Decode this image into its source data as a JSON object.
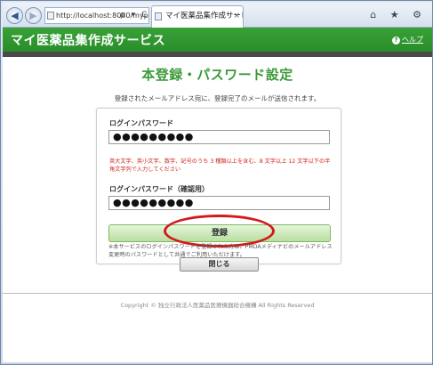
{
  "browser": {
    "back_glyph": "◀",
    "forward_glyph": "▶",
    "address": "http://localhost:8080/mypa",
    "address_icons": "ρ ▾ C",
    "tab_title": "マイ医薬品集作成サービ...",
    "tab_close": "×",
    "tool_icons": "⌂ ★ ⚙"
  },
  "header": {
    "app_title": "マイ医薬品集作成サービス",
    "help_icon_glyph": "?",
    "help_label": "ヘルプ"
  },
  "page": {
    "heading": "本登録・パスワード設定",
    "notice": "登録されたメールアドレス宛に、登録完了のメールが送信されます。"
  },
  "form": {
    "password_label": "ログインパスワード",
    "password_value": "●●●●●●●●●",
    "hint": "英大文字、英小文字、数字、記号のうち 3 種類以上を含む、8 文字以上 12 文字以下の半角文字列で入力してください",
    "confirm_label": "ログインパスワード（確認用）",
    "confirm_value": "●●●●●●●●●",
    "register_label": "登録",
    "footnote": "※本サービスのログインパスワードを登録された方は、PMDAメディナビのメールアドレス変更時のパスワードとして共通でご利用いただけます。"
  },
  "close_label": "閉じる",
  "copyright": "Copyright © 独立行政法人医薬品医療機器総合機構 All Rights Reserved",
  "colors": {
    "brand_green": "#2a8d2a",
    "heading_green": "#3c9a3a",
    "hint_red": "#d0251f",
    "highlight_red": "#d31a1a"
  }
}
